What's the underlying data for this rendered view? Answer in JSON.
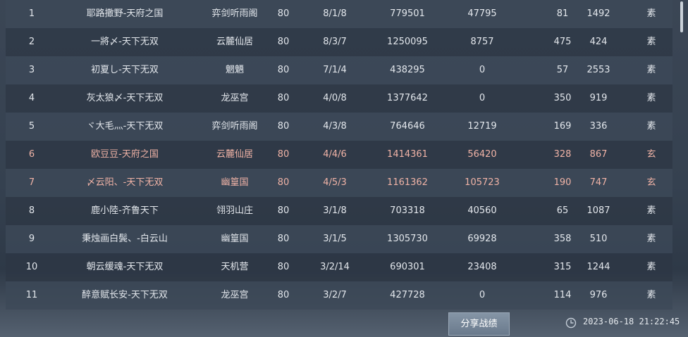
{
  "table": {
    "rows": [
      {
        "rank": "1",
        "name": "耶路撒野-天府之国",
        "guild": "弈剑听雨阁",
        "level": "80",
        "kda": "8/1/8",
        "damage": "779501",
        "heal": "47795",
        "v1": "81",
        "v2": "1492",
        "mark": "素",
        "highlight": false
      },
      {
        "rank": "2",
        "name": "一將〆-天下无双",
        "guild": "云麓仙居",
        "level": "80",
        "kda": "8/3/7",
        "damage": "1250095",
        "heal": "8757",
        "v1": "475",
        "v2": "424",
        "mark": "素",
        "highlight": false
      },
      {
        "rank": "3",
        "name": "初夏し-天下无双",
        "guild": "魍魉",
        "level": "80",
        "kda": "7/1/4",
        "damage": "438295",
        "heal": "0",
        "v1": "57",
        "v2": "2553",
        "mark": "素",
        "highlight": false
      },
      {
        "rank": "4",
        "name": "灰太狼〆-天下无双",
        "guild": "龙巫宫",
        "level": "80",
        "kda": "4/0/8",
        "damage": "1377642",
        "heal": "0",
        "v1": "350",
        "v2": "919",
        "mark": "素",
        "highlight": false
      },
      {
        "rank": "5",
        "name": "ヾ大毛灬-天下无双",
        "guild": "弈剑听雨阁",
        "level": "80",
        "kda": "4/3/8",
        "damage": "764646",
        "heal": "12719",
        "v1": "169",
        "v2": "336",
        "mark": "素",
        "highlight": false
      },
      {
        "rank": "6",
        "name": "欧豆豆-天府之国",
        "guild": "云麓仙居",
        "level": "80",
        "kda": "4/4/6",
        "damage": "1414361",
        "heal": "56420",
        "v1": "328",
        "v2": "867",
        "mark": "玄",
        "highlight": true
      },
      {
        "rank": "7",
        "name": "〆云阳、-天下无双",
        "guild": "幽篁国",
        "level": "80",
        "kda": "4/5/3",
        "damage": "1161362",
        "heal": "105723",
        "v1": "190",
        "v2": "747",
        "mark": "玄",
        "highlight": true
      },
      {
        "rank": "8",
        "name": "鹿小陸-齐鲁天下",
        "guild": "翎羽山庄",
        "level": "80",
        "kda": "3/1/8",
        "damage": "703318",
        "heal": "40560",
        "v1": "65",
        "v2": "1087",
        "mark": "素",
        "highlight": false
      },
      {
        "rank": "9",
        "name": "秉烛画白鬓、-白云山",
        "guild": "幽篁国",
        "level": "80",
        "kda": "3/1/5",
        "damage": "1305730",
        "heal": "69928",
        "v1": "358",
        "v2": "510",
        "mark": "素",
        "highlight": false
      },
      {
        "rank": "10",
        "name": "朝云缓魂-天下无双",
        "guild": "天机营",
        "level": "80",
        "kda": "3/2/14",
        "damage": "690301",
        "heal": "23408",
        "v1": "315",
        "v2": "1244",
        "mark": "素",
        "highlight": false
      },
      {
        "rank": "11",
        "name": "醉意赋长安-天下无双",
        "guild": "龙巫宫",
        "level": "80",
        "kda": "3/2/7",
        "damage": "427728",
        "heal": "0",
        "v1": "114",
        "v2": "976",
        "mark": "素",
        "highlight": false
      }
    ]
  },
  "footer": {
    "share_label": "分享战绩",
    "datetime": "2023-06-18 21:22:45",
    "clock_icon": "clock-icon"
  },
  "colors": {
    "highlight_text": "#f0b3a6",
    "normal_text": "#e3e7ec"
  }
}
